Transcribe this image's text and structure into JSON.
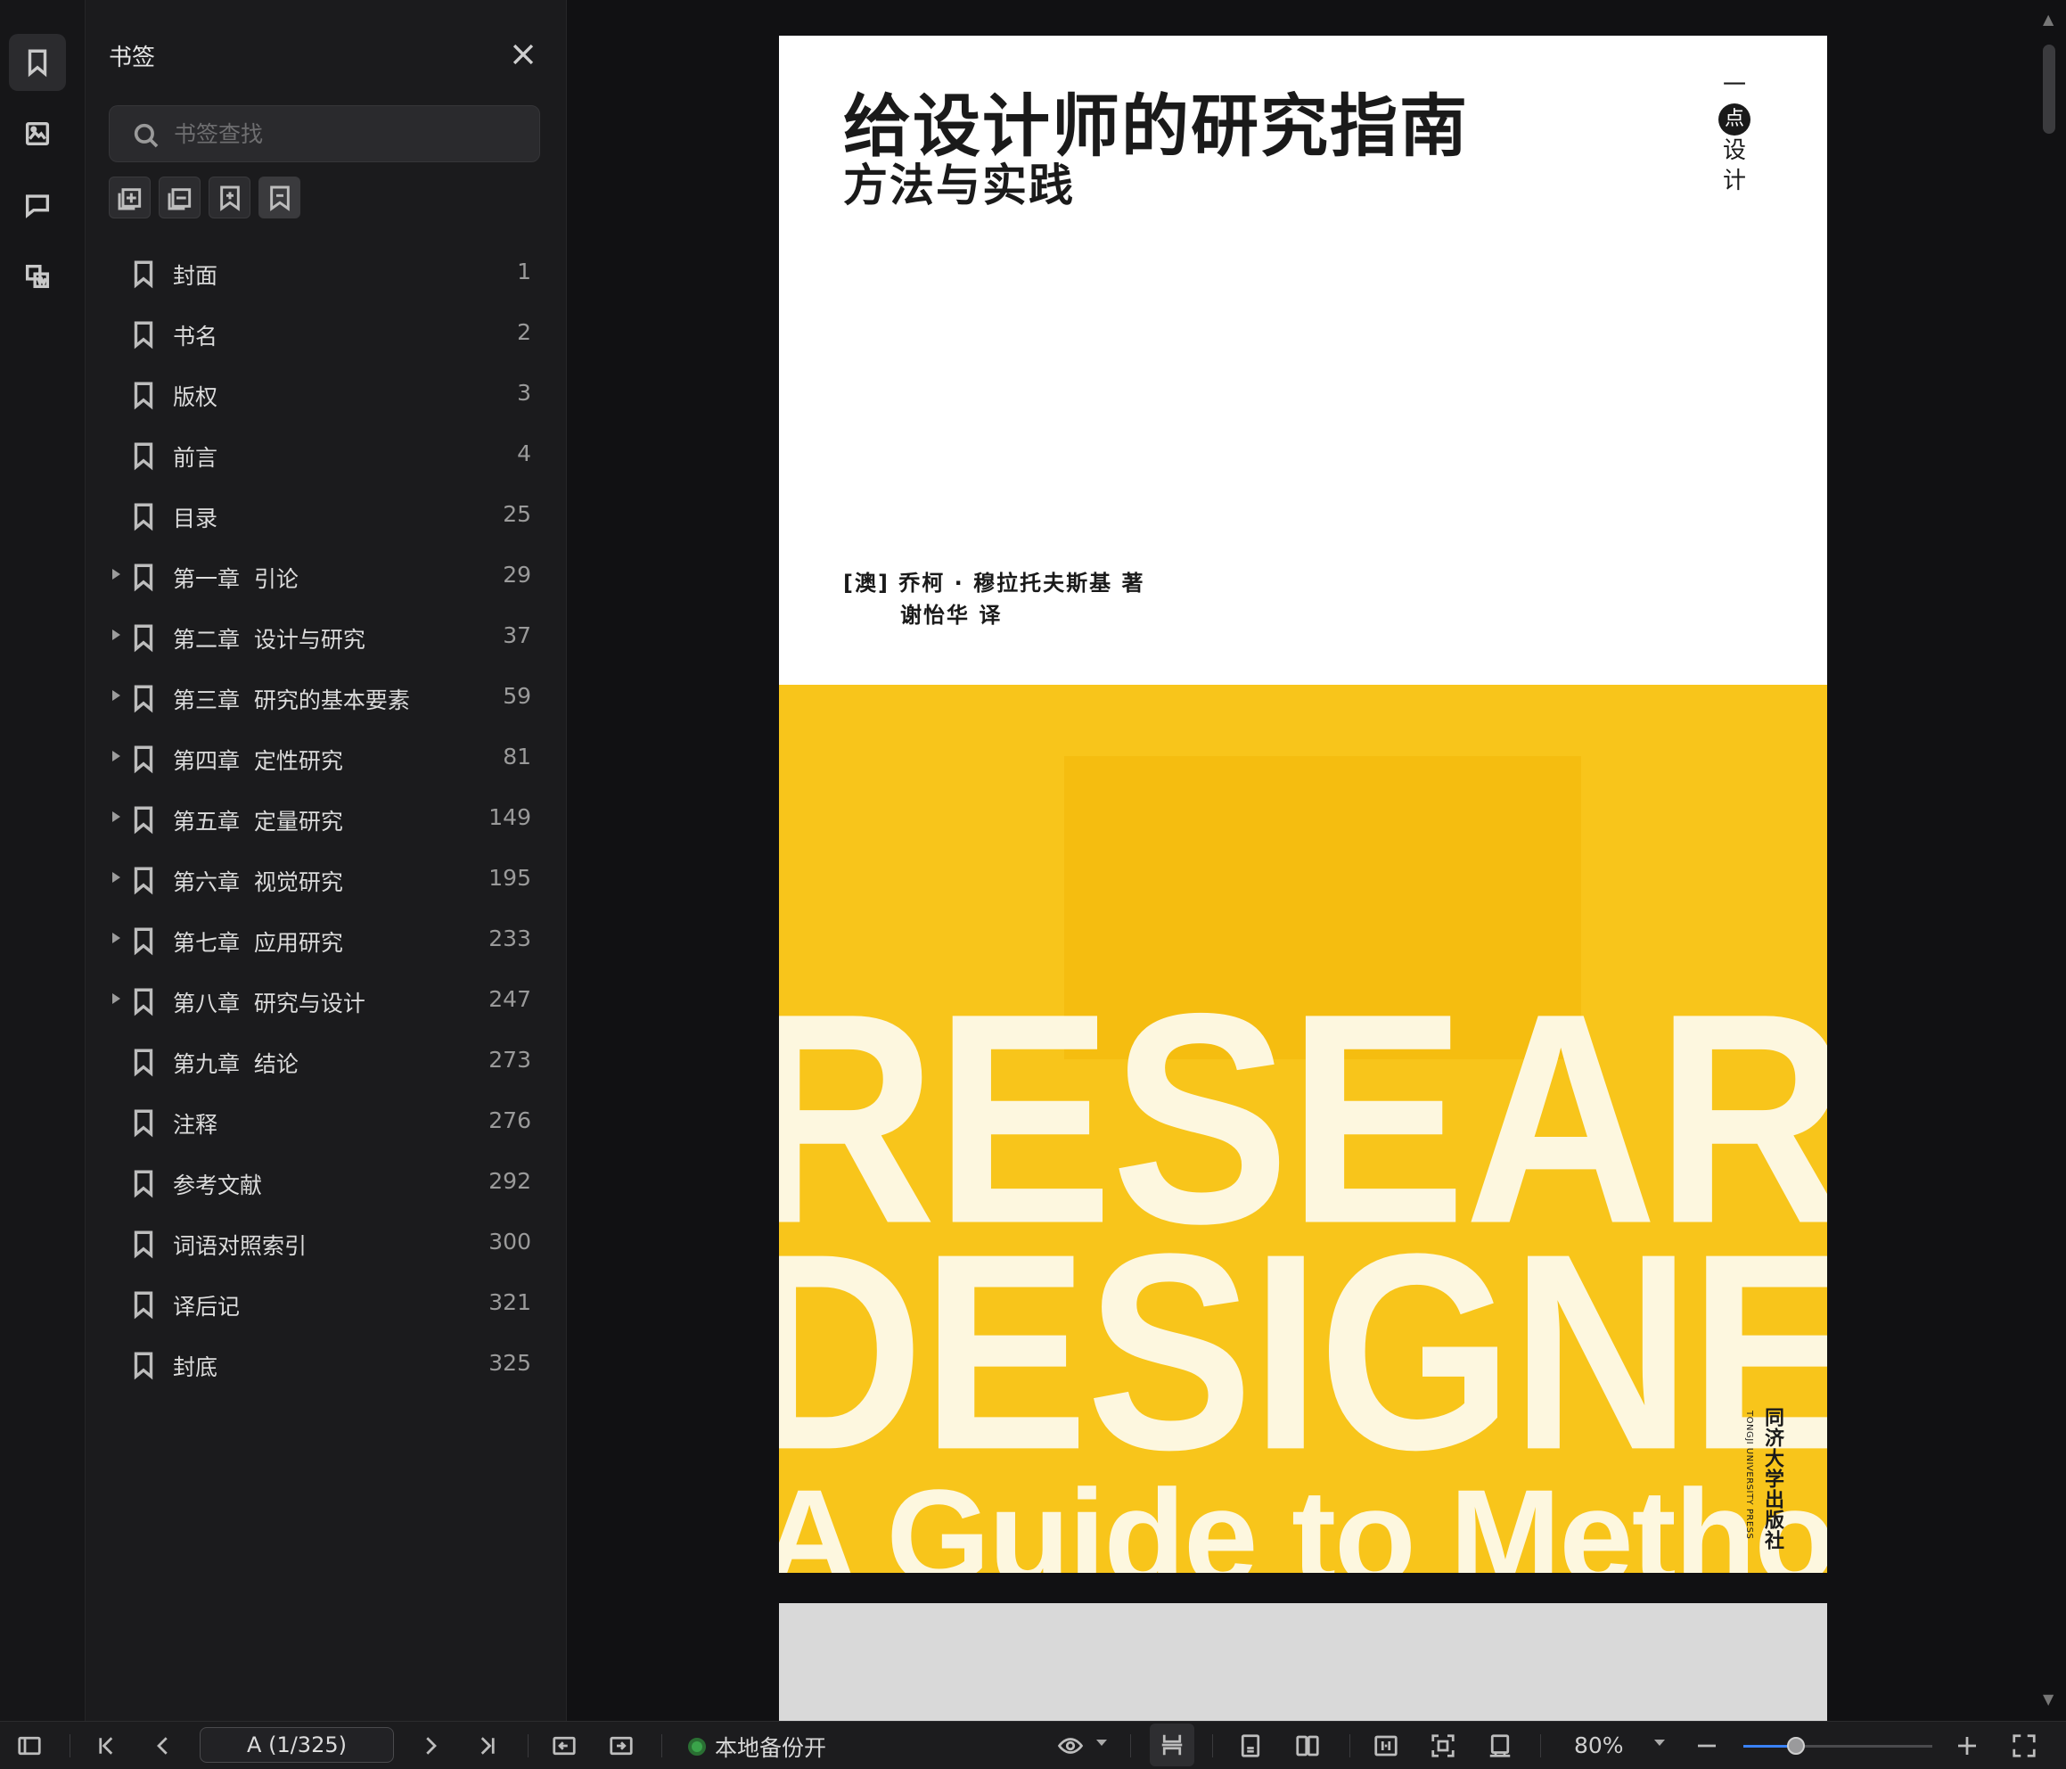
{
  "panel": {
    "title": "书签",
    "search_placeholder": "书签查找"
  },
  "bookmarks": [
    {
      "label": "封面",
      "page": "1",
      "expandable": false
    },
    {
      "label": "书名",
      "page": "2",
      "expandable": false
    },
    {
      "label": "版权",
      "page": "3",
      "expandable": false
    },
    {
      "label": "前言",
      "page": "4",
      "expandable": false
    },
    {
      "label": "目录",
      "page": "25",
      "expandable": false
    },
    {
      "label": "第一章  引论",
      "page": "29",
      "expandable": true
    },
    {
      "label": "第二章  设计与研究",
      "page": "37",
      "expandable": true
    },
    {
      "label": "第三章  研究的基本要素",
      "page": "59",
      "expandable": true
    },
    {
      "label": "第四章  定性研究",
      "page": "81",
      "expandable": true
    },
    {
      "label": "第五章  定量研究",
      "page": "149",
      "expandable": true
    },
    {
      "label": "第六章  视觉研究",
      "page": "195",
      "expandable": true
    },
    {
      "label": "第七章  应用研究",
      "page": "233",
      "expandable": true
    },
    {
      "label": "第八章  研究与设计",
      "page": "247",
      "expandable": true
    },
    {
      "label": "第九章  结论",
      "page": "273",
      "expandable": false
    },
    {
      "label": "注释",
      "page": "276",
      "expandable": false
    },
    {
      "label": "参考文献",
      "page": "292",
      "expandable": false
    },
    {
      "label": "词语对照索引",
      "page": "300",
      "expandable": false
    },
    {
      "label": "译后记",
      "page": "321",
      "expandable": false
    },
    {
      "label": "封底",
      "page": "325",
      "expandable": false
    }
  ],
  "cover": {
    "title": "给设计师的研究指南",
    "subtitle": "方法与实践",
    "series_dash": "一",
    "series_dot": "点",
    "series_rest": "设计",
    "author": "[澳] 乔柯 · 穆拉托夫斯基  著",
    "translator": "谢怡华  译",
    "big_line1": "RESEARC",
    "big_line2": "DESIGNE",
    "big_line3": "A Guide to Methods",
    "publisher_cn": "同济大学出版社",
    "publisher_en": "TONGJI UNIVERSITY PRESS"
  },
  "statusbar": {
    "page_indicator": "A (1/325)",
    "backup_label": "本地备份开",
    "zoom": "80%",
    "zoom_level_fraction": 0.28
  },
  "colors": {
    "accent": "#3a82f7",
    "backup_status": "#3aa34a",
    "cover_yellow": "#f8c51b"
  }
}
